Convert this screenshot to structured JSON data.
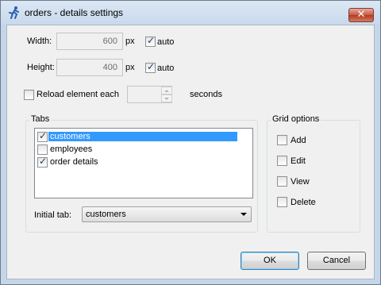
{
  "window": {
    "title": "orders - details settings",
    "close_glyph": "✕",
    "icon": "running-person-icon"
  },
  "size": {
    "width_label": "Width:",
    "width_value": "600",
    "width_unit": "px",
    "width_auto_label": "auto",
    "width_auto_checked": true,
    "height_label": "Height:",
    "height_value": "400",
    "height_unit": "px",
    "height_auto_label": "auto",
    "height_auto_checked": true
  },
  "reload": {
    "label": "Reload element each",
    "checked": false,
    "value": "",
    "unit": "seconds"
  },
  "tabs": {
    "group_title": "Tabs",
    "items": [
      {
        "label": "customers",
        "checked": true,
        "selected": true
      },
      {
        "label": "employees",
        "checked": false,
        "selected": false
      },
      {
        "label": "order details",
        "checked": true,
        "selected": false
      }
    ],
    "initial_tab_label": "Initial tab:",
    "initial_tab_value": "customers"
  },
  "grid_options": {
    "group_title": "Grid options",
    "items": [
      {
        "label": "Add",
        "checked": false
      },
      {
        "label": "Edit",
        "checked": false
      },
      {
        "label": "View",
        "checked": false
      },
      {
        "label": "Delete",
        "checked": false
      }
    ]
  },
  "buttons": {
    "ok": "OK",
    "cancel": "Cancel"
  },
  "colors": {
    "selection": "#3399ff",
    "title_bar": "#c5d5ea",
    "close_button": "#c75a45"
  }
}
